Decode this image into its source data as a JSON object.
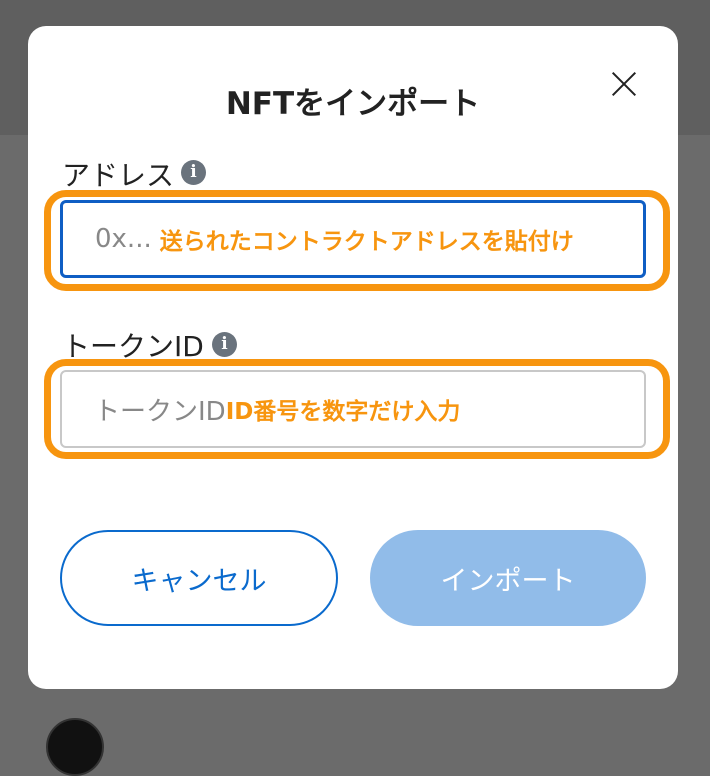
{
  "dialog": {
    "title": "NFTをインポート",
    "close_icon": "close-icon"
  },
  "address_field": {
    "label": "アドレス",
    "info_icon": "info-icon",
    "info_glyph": "i",
    "placeholder": "0x...",
    "annotation": "送られたコントラクトアドレスを貼付け"
  },
  "token_field": {
    "label": "トークンID",
    "info_icon": "info-icon",
    "info_glyph": "i",
    "placeholder": "トークンID",
    "annotation": "ID番号を数字だけ入力"
  },
  "buttons": {
    "cancel": "キャンセル",
    "import": "インポート"
  },
  "colors": {
    "accent_blue": "#0a6acd",
    "highlight_orange": "#f7950f",
    "disabled_button": "#91bce9"
  }
}
